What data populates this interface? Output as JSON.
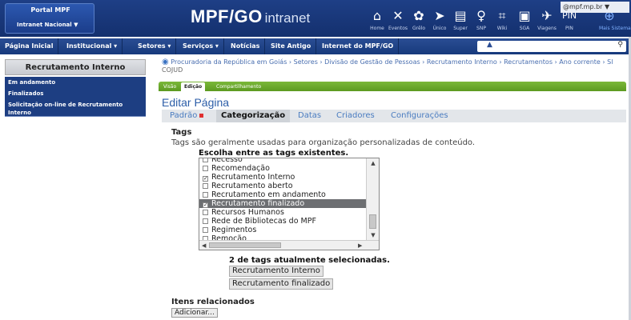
{
  "header": {
    "portal_title": "Portal MPF",
    "portal_select": "Intranet Nacional",
    "brand_main": "MPF/GO",
    "brand_sub": "intranet",
    "email": "@mpf.mp.br",
    "quick_links": [
      {
        "label": "Home",
        "icon": "home-icon"
      },
      {
        "label": "Eventos",
        "icon": "events-icon"
      },
      {
        "label": "Grêlo",
        "icon": "bird-icon"
      },
      {
        "label": "Único",
        "icon": "single-icon"
      },
      {
        "label": "Super",
        "icon": "super-icon"
      },
      {
        "label": "SNP",
        "icon": "snp-icon"
      },
      {
        "label": "Wiki",
        "icon": "wiki-icon"
      },
      {
        "label": "SGA",
        "icon": "sga-icon"
      },
      {
        "label": "Viagens",
        "icon": "travel-icon"
      },
      {
        "label": "PIN",
        "icon": "pin-icon"
      },
      {
        "label": "Mais Sistemas",
        "icon": "more-systems-icon"
      }
    ],
    "pin_text": "PIN"
  },
  "nav": {
    "items": [
      {
        "label": "Página Inicial"
      },
      {
        "label": "Institucional ▾"
      },
      {
        "label": "Setores ▾"
      },
      {
        "label": "Serviços ▾"
      },
      {
        "label": "Notícias"
      },
      {
        "label": "Site Antigo"
      },
      {
        "label": "Internet do MPF/GO"
      }
    ]
  },
  "sidebar": {
    "heading": "Recrutamento Interno",
    "links": [
      {
        "label": "Em andamento"
      },
      {
        "label": "Finalizados"
      },
      {
        "label": "Solicitação on-line de Recrutamento Interno"
      }
    ]
  },
  "breadcrumb": {
    "text": "Procuradoria da República em Goiás › Setores › Divisão de Gestão de Pessoas › Recrutamento Interno › Recrutamentos › Ano corrente › Sl",
    "sub": "COJUD"
  },
  "edit_tabs": {
    "items": [
      {
        "label": "Visão"
      },
      {
        "label": "Edição"
      },
      {
        "label": "Compartilhamento"
      }
    ]
  },
  "page_title": "Editar Página",
  "section_tabs": {
    "items": [
      {
        "label": "Padrão"
      },
      {
        "label": "Categorização"
      },
      {
        "label": "Datas"
      },
      {
        "label": "Criadores"
      },
      {
        "label": "Configurações"
      }
    ]
  },
  "tags": {
    "label": "Tags",
    "help": "Tags são geralmente usadas para organização personalizadas de conteúdo.",
    "choose": "Escolha entre as tags existentes.",
    "items": [
      {
        "label": "Recesso",
        "checked": false
      },
      {
        "label": "Recomendação",
        "checked": false
      },
      {
        "label": "Recrutamento Interno",
        "checked": true
      },
      {
        "label": "Recrutamento aberto",
        "checked": false
      },
      {
        "label": "Recrutamento em andamento",
        "checked": false
      },
      {
        "label": "Recrutamento finalizado",
        "checked": true
      },
      {
        "label": "Recursos Humanos",
        "checked": false
      },
      {
        "label": "Rede de Bibliotecas do MPF",
        "checked": false
      },
      {
        "label": "Regimentos",
        "checked": false
      },
      {
        "label": "Remoção",
        "checked": false
      }
    ],
    "count_label": "2 de tags atualmente selecionadas.",
    "selected": [
      {
        "label": "Recrutamento Interno"
      },
      {
        "label": "Recrutamento finalizado"
      }
    ]
  },
  "related": {
    "label": "Itens relacionados",
    "add_button": "Adicionar..."
  }
}
